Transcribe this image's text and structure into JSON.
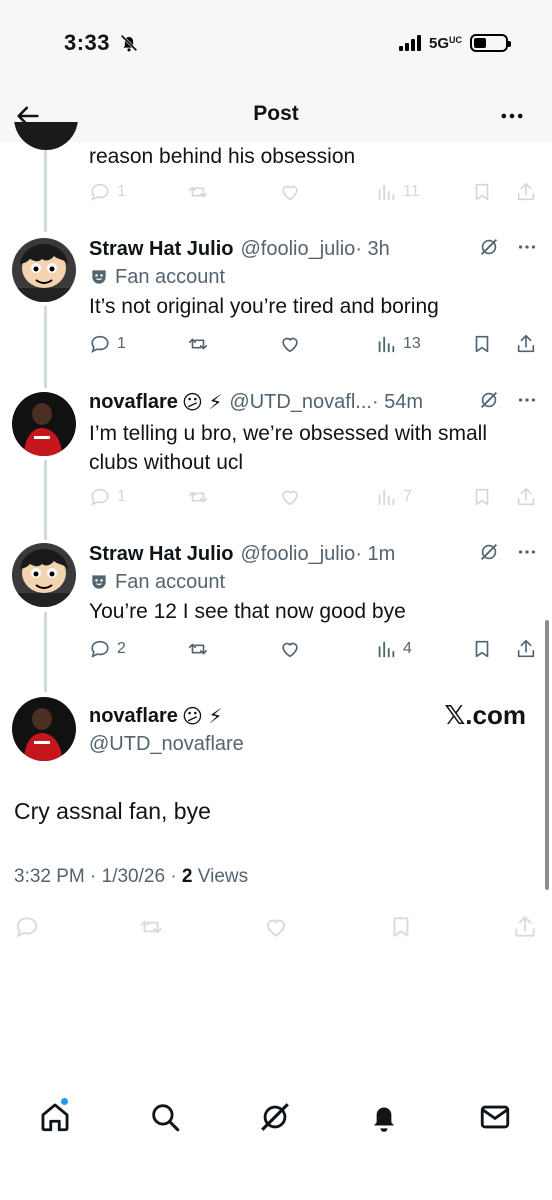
{
  "status_bar": {
    "time": "3:33",
    "network": "5G",
    "network_badge": "UC"
  },
  "header": {
    "title": "Post",
    "back_icon": "arrow-left-icon",
    "more_icon": "more-dots-icon"
  },
  "previous_reply": {
    "text_tail": "reason behind his obsession",
    "replies": "1",
    "reposts": "",
    "likes": "",
    "views": "11"
  },
  "replies": [
    {
      "display_name": "Straw Hat Julio",
      "handle": "@foolio_julio",
      "time": "· 3h",
      "badge": "Fan account",
      "text": "It’s not original you’re tired and boring",
      "replies": "1",
      "views": "13"
    },
    {
      "display_name": "novaflare",
      "emoji": "😕 ⚡",
      "handle": "@UTD_novafl...",
      "time": "· 54m",
      "text": "I’m telling u bro, we’re obsessed with small clubs without ucl",
      "replies": "1",
      "views": "7"
    },
    {
      "display_name": "Straw Hat Julio",
      "handle": "@foolio_julio",
      "time": "· 1m",
      "badge": "Fan account",
      "text": "You’re 12 I see that now good bye",
      "replies": "2",
      "views": "4"
    }
  ],
  "main_post": {
    "display_name": "novaflare",
    "emoji": "😕 ⚡",
    "handle": "@UTD_novaflare",
    "watermark": "𝕏.com",
    "text": "Cry assnal fan, bye",
    "timestamp": "3:32 PM · 1/30/26 · ",
    "views_count": "2",
    "views_label": " Views"
  },
  "tabs": [
    "home-icon",
    "search-icon",
    "grok-icon",
    "notifications-bell-icon",
    "messages-envelope-icon"
  ],
  "colors": {
    "accent": "#1d9bf0",
    "text": "#0f1419",
    "muted": "#536471",
    "line": "#cfd9de"
  }
}
